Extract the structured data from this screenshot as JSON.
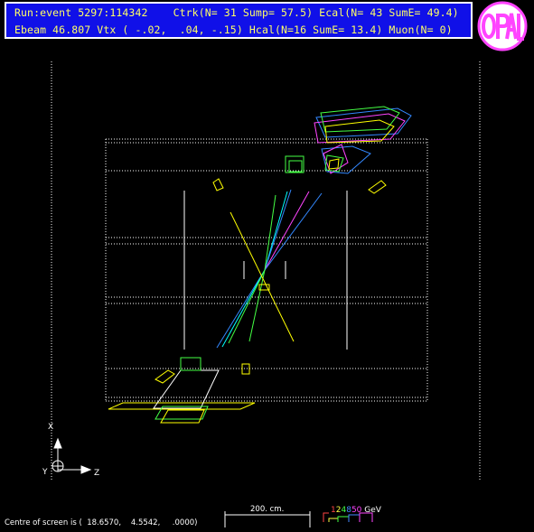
{
  "header": {
    "line1": {
      "run_event": "Run:event 5297:114342",
      "ctrk": "Ctrk(N= 31 Sump= 57.5)",
      "ecal": "Ecal(N= 43 SumE= 49.4)"
    },
    "line2": {
      "beam_vtx": "Ebeam 46.807 Vtx ( -.02,  .04, -.15)",
      "hcal": "Hcal(N=16 SumE= 13.4)",
      "muon": "Muon(N= 0)"
    }
  },
  "logo": {
    "text": "OPAL",
    "ring_color": "#ff44ff"
  },
  "axes": {
    "x": "X",
    "y": "Y",
    "z": "Z"
  },
  "footer": {
    "centre_text": "Centre of screen is (  18.6570,    4.5542,     .0000)",
    "scale_label": "200. cm."
  },
  "energy_scale": {
    "labels": [
      {
        "text": "1",
        "color": "#ff4444"
      },
      {
        "text": "2",
        "color": "#ffff44"
      },
      {
        "text": "4",
        "color": "#44ff44"
      },
      {
        "text": "8",
        "color": "#4488ff"
      },
      {
        "text": "50",
        "color": "#ff44ff"
      },
      {
        "text": " GeV",
        "color": "#ffffff"
      }
    ]
  },
  "colors": {
    "header_bg": "#1010e8",
    "header_text": "#ffff66",
    "detector": "#ffffff",
    "ecal": "#ffff00",
    "hcal": "#44ff44",
    "track_blue": "#3388ff",
    "track_cyan": "#00ffff",
    "track_magenta": "#ff44ff"
  }
}
